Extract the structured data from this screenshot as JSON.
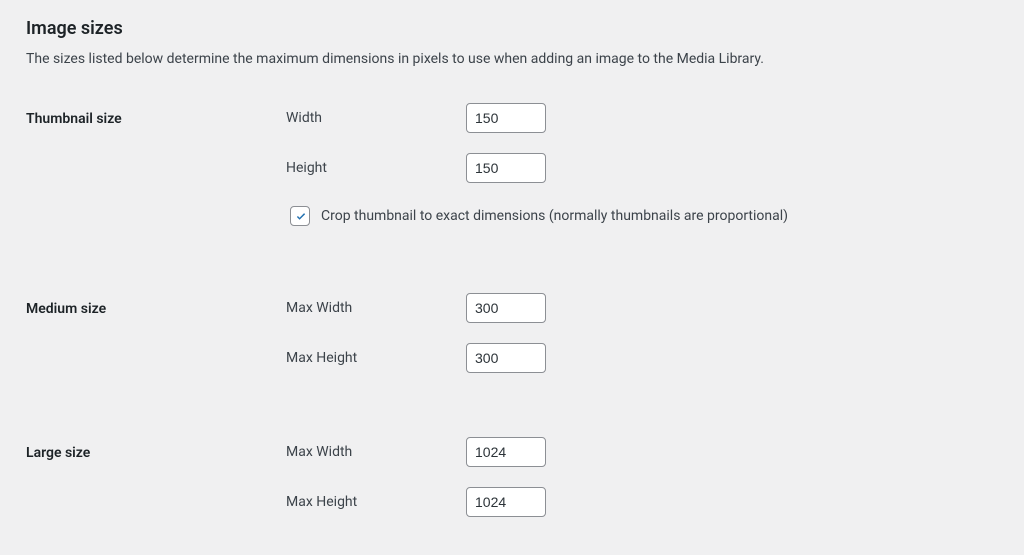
{
  "section": {
    "title": "Image sizes",
    "description": "The sizes listed below determine the maximum dimensions in pixels to use when adding an image to the Media Library."
  },
  "thumbnail": {
    "heading": "Thumbnail size",
    "width_label": "Width",
    "width_value": "150",
    "height_label": "Height",
    "height_value": "150",
    "crop_checked": true,
    "crop_label": "Crop thumbnail to exact dimensions (normally thumbnails are proportional)"
  },
  "medium": {
    "heading": "Medium size",
    "max_width_label": "Max Width",
    "max_width_value": "300",
    "max_height_label": "Max Height",
    "max_height_value": "300"
  },
  "large": {
    "heading": "Large size",
    "max_width_label": "Max Width",
    "max_width_value": "1024",
    "max_height_label": "Max Height",
    "max_height_value": "1024"
  }
}
